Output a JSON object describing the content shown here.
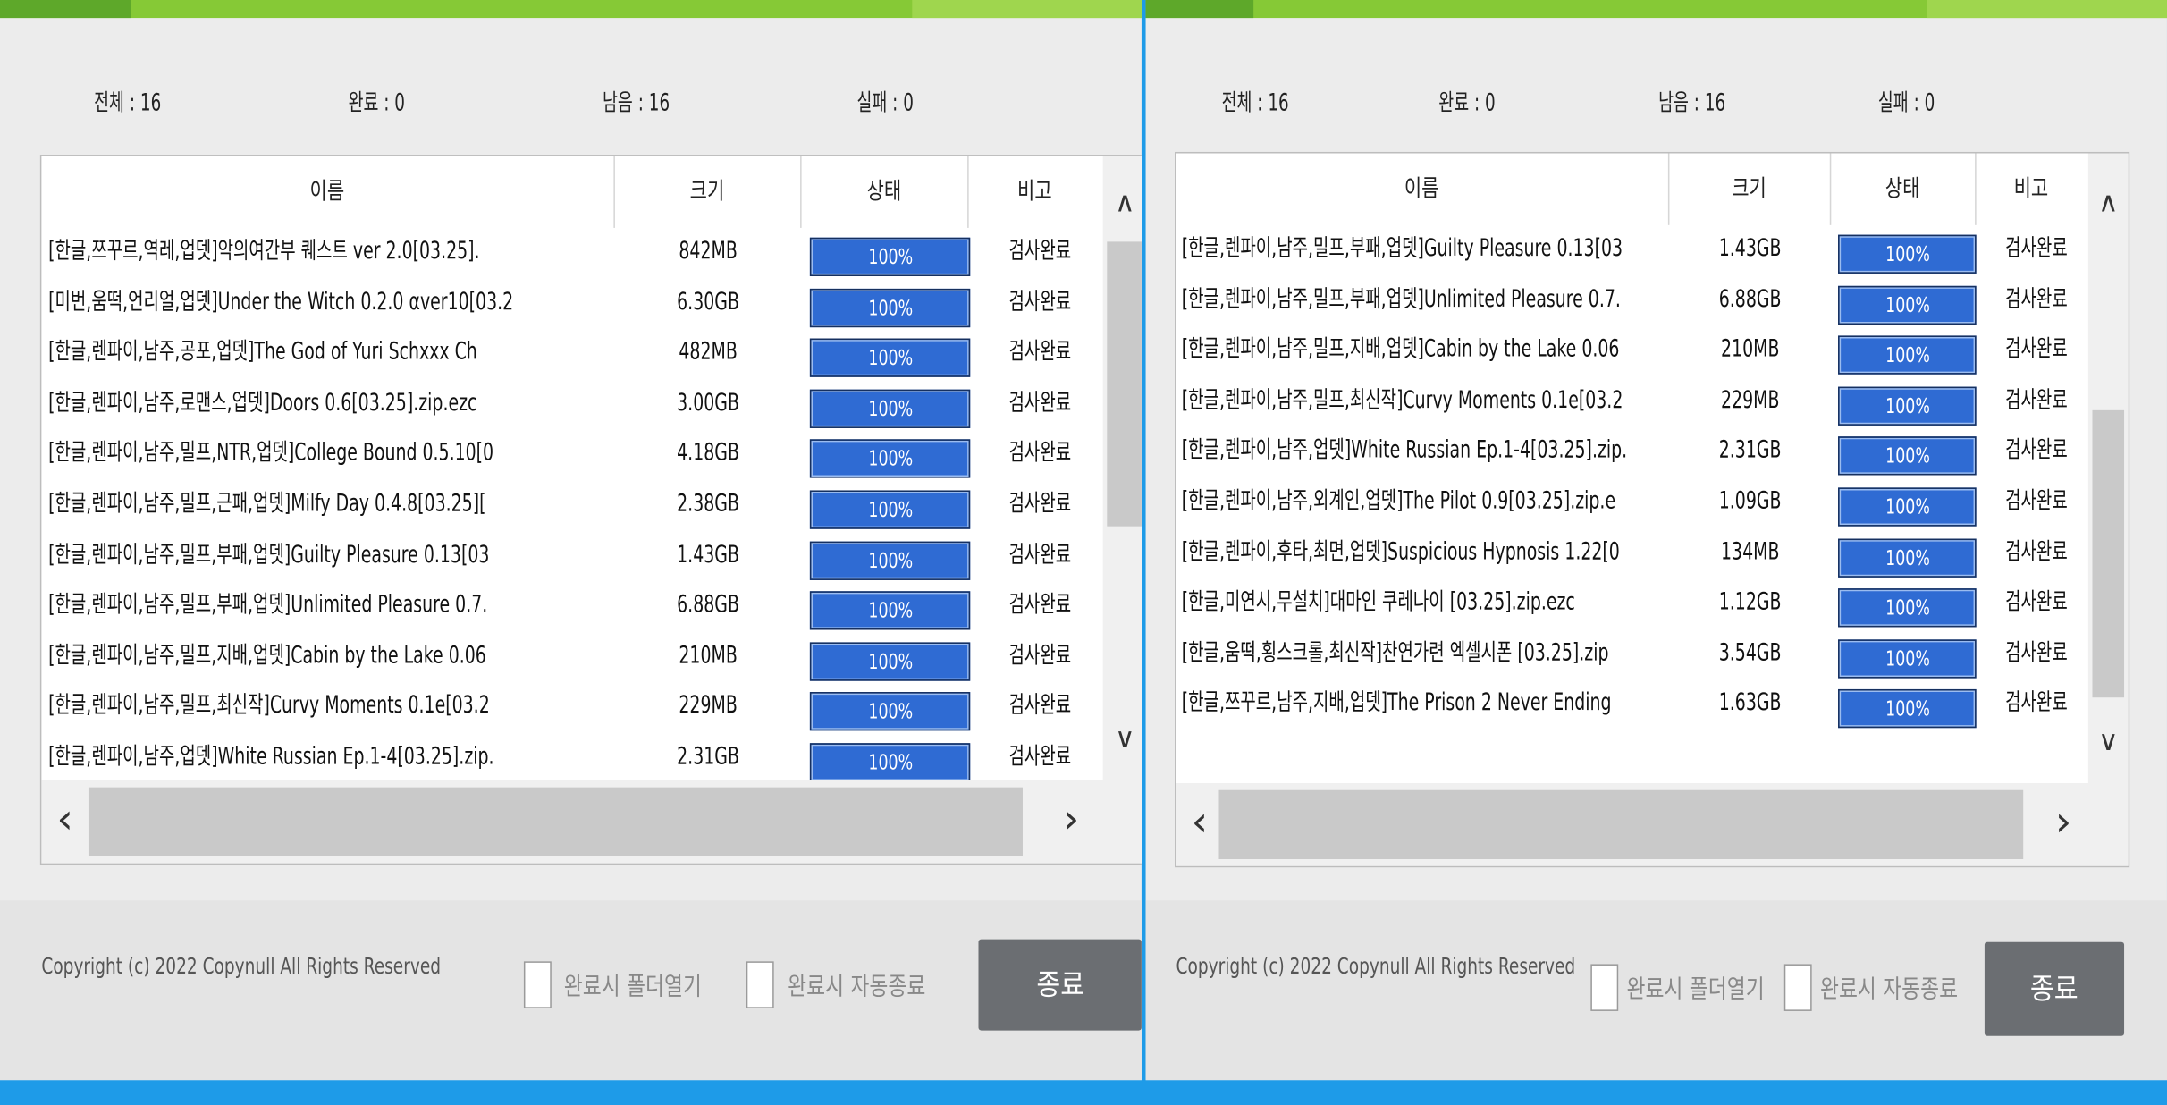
{
  "left": {
    "stats": {
      "total": "전체 : 16",
      "done": "완료 : 0",
      "remaining": "남음 : 16",
      "failed": "실패 : 0"
    },
    "columns": [
      "이름",
      "크기",
      "상태",
      "비고"
    ],
    "rows": [
      {
        "name": "[한글,쯔꾸르,역레,업뎃]악의여간부 퀘스트 ver 2.0[03.25].",
        "size": "842MB",
        "status": "100%",
        "progress": 1.0,
        "note": "검사완료"
      },
      {
        "name": "[미번,움떡,언리얼,업뎃]Under the Witch 0.2.0 αver10[03.2",
        "size": "6.30GB",
        "status": "100%",
        "progress": 1.0,
        "note": "검사완료"
      },
      {
        "name": "[한글,렌파이,남주,공포,업뎃]The God of Yuri Schxxx Ch",
        "size": "482MB",
        "status": "100%",
        "progress": 1.0,
        "note": "검사완료"
      },
      {
        "name": "[한글,렌파이,남주,로맨스,업뎃]Doors 0.6[03.25].zip.ezc",
        "size": "3.00GB",
        "status": "100%",
        "progress": 1.0,
        "note": "검사완료"
      },
      {
        "name": "[한글,렌파이,남주,밀프,NTR,업뎃]College Bound 0.5.10[0",
        "size": "4.18GB",
        "status": "100%",
        "progress": 1.0,
        "note": "검사완료"
      },
      {
        "name": "[한글,렌파이,남주,밀프,근패,업뎃]Milfy Day 0.4.8[03.25][",
        "size": "2.38GB",
        "status": "100%",
        "progress": 1.0,
        "note": "검사완료"
      },
      {
        "name": "[한글,렌파이,남주,밀프,부패,업뎃]Guilty Pleasure 0.13[03",
        "size": "1.43GB",
        "status": "100%",
        "progress": 1.0,
        "note": "검사완료"
      },
      {
        "name": "[한글,렌파이,남주,밀프,부패,업뎃]Unlimited Pleasure 0.7.",
        "size": "6.88GB",
        "status": "100%",
        "progress": 1.0,
        "note": "검사완료"
      },
      {
        "name": "[한글,렌파이,남주,밀프,지배,업뎃]Cabin by the Lake 0.06",
        "size": "210MB",
        "status": "100%",
        "progress": 1.0,
        "note": "검사완료"
      },
      {
        "name": "[한글,렌파이,남주,밀프,최신작]Curvy Moments 0.1e[03.2",
        "size": "229MB",
        "status": "100%",
        "progress": 1.0,
        "note": "검사완료"
      },
      {
        "name": "[한글,렌파이,남주,업뎃]White Russian Ep.1-4[03.25].zip.",
        "size": "2.31GB",
        "status": "100%",
        "progress": 1.0,
        "note": "검사완료"
      }
    ],
    "copyright": "Copyright (c) 2022 Copynull All Rights Reserved",
    "open_folder_label": "완료시 폴더열기",
    "auto_close_label": "완료시 자동종료",
    "close_label": "종료"
  },
  "right": {
    "stats": {
      "total": "전체 : 16",
      "done": "완료 : 0",
      "remaining": "남음 : 16",
      "failed": "실패 : 0"
    },
    "columns": [
      "이름",
      "크기",
      "상태",
      "비고"
    ],
    "rows": [
      {
        "name": "[한글,렌파이,남주,밀프,부패,업뎃]Guilty Pleasure 0.13[03",
        "size": "1.43GB",
        "status": "100%",
        "progress": 1.0,
        "note": "검사완료"
      },
      {
        "name": "[한글,렌파이,남주,밀프,부패,업뎃]Unlimited Pleasure 0.7.",
        "size": "6.88GB",
        "status": "100%",
        "progress": 1.0,
        "note": "검사완료"
      },
      {
        "name": "[한글,렌파이,남주,밀프,지배,업뎃]Cabin by the Lake 0.06",
        "size": "210MB",
        "status": "100%",
        "progress": 1.0,
        "note": "검사완료"
      },
      {
        "name": "[한글,렌파이,남주,밀프,최신작]Curvy Moments 0.1e[03.2",
        "size": "229MB",
        "status": "100%",
        "progress": 1.0,
        "note": "검사완료"
      },
      {
        "name": "[한글,렌파이,남주,업뎃]White Russian Ep.1-4[03.25].zip.",
        "size": "2.31GB",
        "status": "100%",
        "progress": 1.0,
        "note": "검사완료"
      },
      {
        "name": "[한글,렌파이,남주,외계인,업뎃]The Pilot 0.9[03.25].zip.e",
        "size": "1.09GB",
        "status": "100%",
        "progress": 1.0,
        "note": "검사완료"
      },
      {
        "name": "[한글,렌파이,후타,최면,업뎃]Suspicious Hypnosis 1.22[0",
        "size": "134MB",
        "status": "100%",
        "progress": 1.0,
        "note": "검사완료"
      },
      {
        "name": "[한글,미연시,무설치]대마인 쿠레나이 [03.25].zip.ezc",
        "size": "1.12GB",
        "status": "100%",
        "progress": 1.0,
        "note": "검사완료"
      },
      {
        "name": "[한글,움떡,횡스크롤,최신작]찬연가련 엑셀시폰 [03.25].zip",
        "size": "3.54GB",
        "status": "100%",
        "progress": 1.0,
        "note": "검사완료"
      },
      {
        "name": "[한글,쯔꾸르,남주,지배,업뎃]The Prison 2 Never Ending",
        "size": "1.63GB",
        "status": "100%",
        "progress": 1.0,
        "note": "검사완료"
      }
    ],
    "copyright": "Copyright (c) 2022 Copynull All Rights Reserved",
    "open_folder_label": "완료시 폴더열기",
    "auto_close_label": "완료시 자동종료",
    "close_label": "종료"
  },
  "colors": {
    "progress_bar": "#2f6bd3",
    "top_progress": "#86c936",
    "desktop_bg": "#1e9be8",
    "close_button": "#6b6e72"
  },
  "icons": {
    "scroll_up": "chevron-up-icon",
    "scroll_down": "chevron-down-icon",
    "scroll_left": "chevron-left-icon",
    "scroll_right": "chevron-right-icon"
  }
}
